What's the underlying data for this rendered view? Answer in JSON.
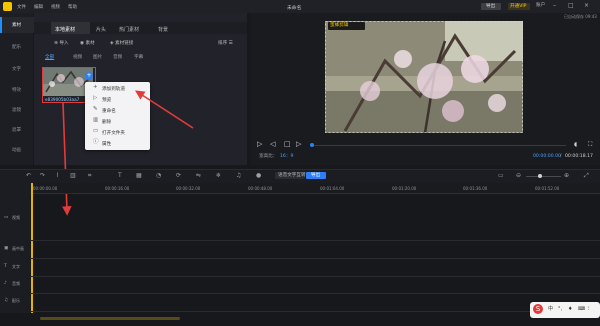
{
  "app": {
    "title": "未命名",
    "menus": [
      "文件",
      "编辑",
      "视频",
      "帮助"
    ],
    "export_label": "导出",
    "vip_label": "开通VIP",
    "account_label": "账户",
    "autosave": "已自动保存 09:43"
  },
  "sidebar": {
    "items": [
      {
        "label": "素材"
      },
      {
        "label": "配乐"
      },
      {
        "label": "文字"
      },
      {
        "label": "特效"
      },
      {
        "label": "滤镜"
      },
      {
        "label": "遮罩"
      },
      {
        "label": "动画"
      }
    ]
  },
  "media": {
    "tabs": [
      "本地素材",
      "片头",
      "热门素材",
      "背景"
    ],
    "toolbar": [
      "导入",
      "素材",
      "素材链接"
    ],
    "sort_label": "排序",
    "filters": [
      "全部",
      "视频",
      "图片",
      "音频",
      "字幕"
    ],
    "clip_name": "e839005b03aa7"
  },
  "context_menu": {
    "items": [
      {
        "label": "添加到轨道",
        "icon": "plus-icon"
      },
      {
        "label": "预览",
        "icon": "play-icon"
      },
      {
        "label": "重命名",
        "icon": "pencil-icon"
      },
      {
        "label": "删除",
        "icon": "trash-icon"
      },
      {
        "label": "打开文件夹",
        "icon": "folder-icon"
      },
      {
        "label": "属性",
        "icon": "info-icon"
      }
    ]
  },
  "preview": {
    "watermark": "蜜蜂剪辑",
    "ratio_label": "宽高比：",
    "ratio_value": "16：9",
    "current_time": "00:00:00.00",
    "total_time": "00:00:18.17"
  },
  "timeline": {
    "ruler": [
      "00:00:00.00",
      "00:00:16.00",
      "00:00:32.00",
      "00:00:48.00",
      "00:01:04.00",
      "00:01:20.00",
      "00:01:36.00",
      "00:01:52.00"
    ],
    "buttons": [
      "语音文字互转",
      "导出"
    ],
    "tracks": [
      "视频",
      "画中画",
      "文字",
      "音频",
      "配乐"
    ]
  },
  "colors": {
    "accent": "#1e90ff",
    "highlight": "#e23b3b",
    "brand_yellow": "#f2c700"
  }
}
